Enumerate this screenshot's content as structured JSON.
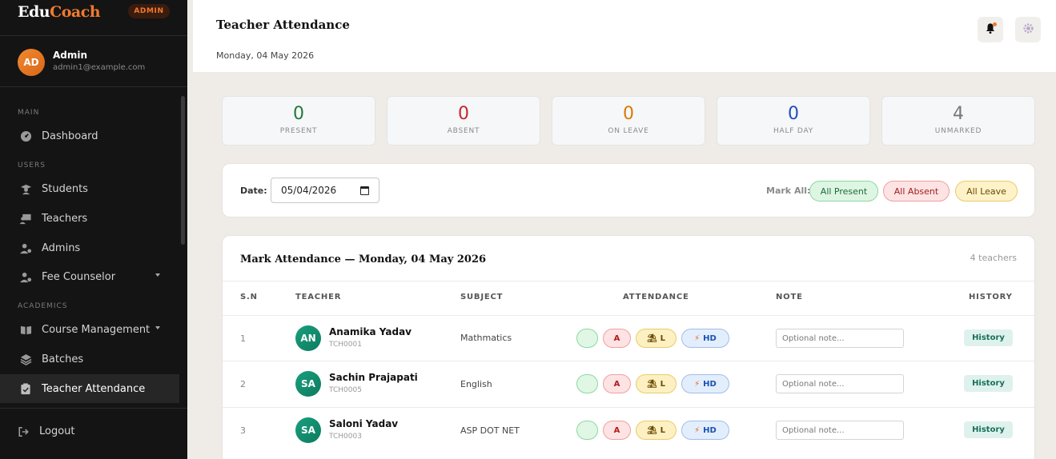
{
  "brand": {
    "part1": "Edu",
    "part2": "Coach",
    "badge": "ADMIN"
  },
  "profile": {
    "initials": "AD",
    "name": "Admin",
    "email": "admin1@example.com"
  },
  "sidebar": {
    "sections": {
      "main": "MAIN",
      "users": "USERS",
      "academics": "ACADEMICS"
    },
    "items": {
      "dashboard": "Dashboard",
      "students": "Students",
      "teachers": "Teachers",
      "admins": "Admins",
      "fee_counselor": "Fee Counselor",
      "course_management": "Course Management",
      "batches": "Batches",
      "teacher_attendance": "Teacher Attendance"
    },
    "logout": "Logout"
  },
  "header": {
    "title": "Teacher Attendance",
    "date": "Monday, 04 May 2026"
  },
  "stats": [
    {
      "value": "0",
      "label": "PRESENT",
      "color": "#1f7a3a"
    },
    {
      "value": "0",
      "label": "ABSENT",
      "color": "#c62828"
    },
    {
      "value": "0",
      "label": "ON LEAVE",
      "color": "#d97a06"
    },
    {
      "value": "0",
      "label": "HALF DAY",
      "color": "#1e4fc0"
    },
    {
      "value": "4",
      "label": "UNMARKED",
      "color": "#777777"
    }
  ],
  "filter": {
    "date_label": "Date:",
    "date_value": "05/04/2026",
    "mark_all_label": "Mark All:",
    "all_present": "All Present",
    "all_absent": "All Absent",
    "all_leave": "All Leave"
  },
  "table": {
    "title": "Mark Attendance — Monday, 04 May 2026",
    "count": "4 teachers",
    "headers": {
      "sn": "S.N",
      "teacher": "TEACHER",
      "subject": "SUBJECT",
      "attendance": "ATTENDANCE",
      "note": "NOTE",
      "history": "HISTORY"
    },
    "attendance_options": {
      "present": "",
      "absent": "A",
      "leave": "L",
      "half_day": "HD"
    },
    "note_placeholder": "Optional note...",
    "history_label": "History",
    "rows": [
      {
        "sn": "1",
        "initials": "AN",
        "name": "Anamika Yadav",
        "id": "TCH0001",
        "subject": "Mathmatics"
      },
      {
        "sn": "2",
        "initials": "SA",
        "name": "Sachin Prajapati",
        "id": "TCH0005",
        "subject": "English"
      },
      {
        "sn": "3",
        "initials": "SA",
        "name": "Saloni Yadav",
        "id": "TCH0003",
        "subject": "ASP DOT NET"
      }
    ]
  }
}
